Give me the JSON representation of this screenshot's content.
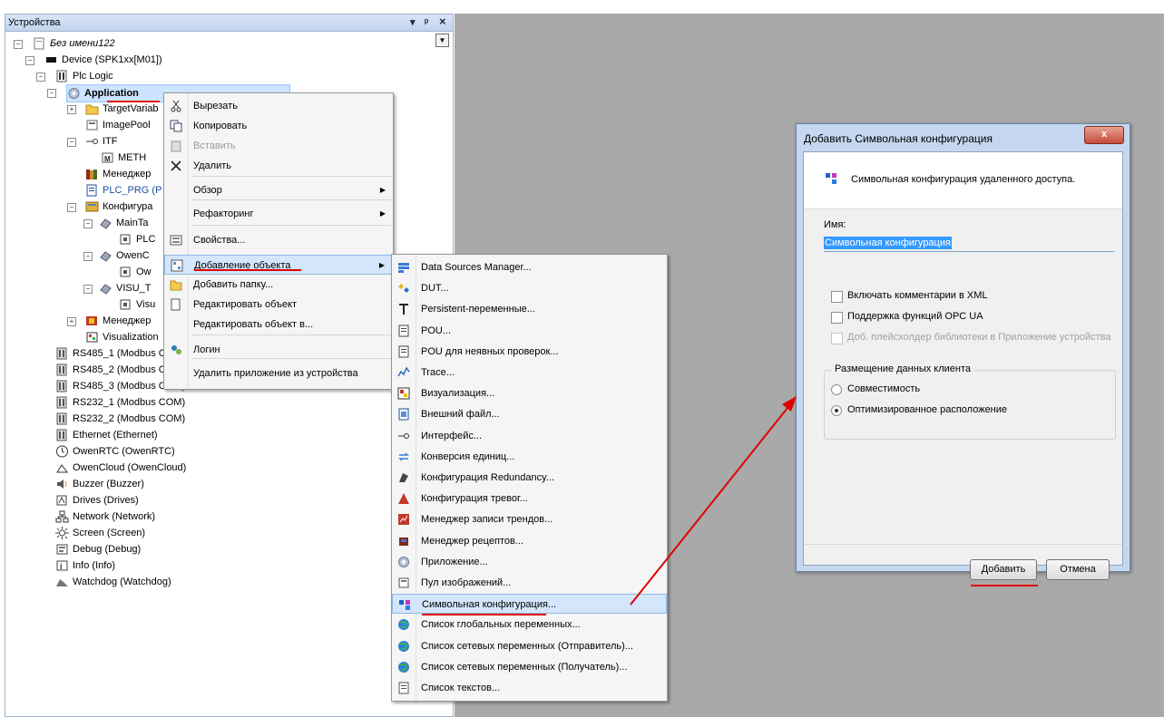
{
  "panel": {
    "title": "Устройства",
    "ctrl_pin": "▾",
    "ctrl_dock": "ᵖ",
    "ctrl_close": "×"
  },
  "tree": [
    {
      "label": "Без имени122",
      "icon": "project-icon"
    },
    {
      "label": "Device (SPK1xx[M01])",
      "icon": "device-icon"
    },
    {
      "label": "Plc Logic",
      "icon": "plc-logic-icon"
    },
    {
      "label": "Application",
      "icon": "application-gear-icon"
    },
    {
      "label": "TargetVariab",
      "icon": "folder-icon"
    },
    {
      "label": "ImagePool",
      "icon": "image-pool-icon"
    },
    {
      "label": "ITF",
      "icon": "interface-icon"
    },
    {
      "label": "METH",
      "icon": "method-icon"
    },
    {
      "label": "Менеджер",
      "icon": "library-manager-icon"
    },
    {
      "label": "PLC_PRG (P",
      "icon": "pou-icon"
    },
    {
      "label": "Конфигура",
      "icon": "task-config-icon"
    },
    {
      "label": "MainTa",
      "icon": "task-icon"
    },
    {
      "label": "PLC",
      "icon": "pou-call-icon"
    },
    {
      "label": "OwenC",
      "icon": "task-icon"
    },
    {
      "label": "Ow",
      "icon": "pou-call-icon"
    },
    {
      "label": "VISU_T",
      "icon": "task-icon"
    },
    {
      "label": "Visu",
      "icon": "pou-call-icon"
    },
    {
      "label": "Менеджер",
      "icon": "visu-manager-icon"
    },
    {
      "label": "Visualization",
      "icon": "visualization-icon"
    },
    {
      "label": "RS485_1 (Modbus C",
      "icon": "port-icon"
    },
    {
      "label": "RS485_2 (Modbus COM)",
      "icon": "port-icon"
    },
    {
      "label": "RS485_3 (Modbus COM)",
      "icon": "port-icon"
    },
    {
      "label": "RS232_1 (Modbus COM)",
      "icon": "port-icon"
    },
    {
      "label": "RS232_2 (Modbus COM)",
      "icon": "port-icon"
    },
    {
      "label": "Ethernet (Ethernet)",
      "icon": "port-icon"
    },
    {
      "label": "OwenRTC (OwenRTC)",
      "icon": "clock-icon"
    },
    {
      "label": "OwenCloud (OwenCloud)",
      "icon": "cloud-icon"
    },
    {
      "label": "Buzzer (Buzzer)",
      "icon": "speaker-icon"
    },
    {
      "label": "Drives (Drives)",
      "icon": "drives-icon"
    },
    {
      "label": "Network (Network)",
      "icon": "network-icon"
    },
    {
      "label": "Screen (Screen)",
      "icon": "screen-icon"
    },
    {
      "label": "Debug (Debug)",
      "icon": "debug-icon"
    },
    {
      "label": "Info (Info)",
      "icon": "info-icon"
    },
    {
      "label": "Watchdog (Watchdog)",
      "icon": "watchdog-icon"
    }
  ],
  "context_menu": [
    {
      "label": "Вырезать",
      "icon": "scissors-icon",
      "disabled": false
    },
    {
      "label": "Копировать",
      "icon": "copy-icon",
      "disabled": false
    },
    {
      "label": "Вставить",
      "icon": "paste-icon",
      "disabled": true
    },
    {
      "label": "Удалить",
      "icon": "delete-x-icon",
      "disabled": false
    },
    {
      "label": "Обзор",
      "icon": "",
      "submenu": true
    },
    {
      "label": "Рефакторинг",
      "icon": "",
      "submenu": true
    },
    {
      "label": "Свойства...",
      "icon": "properties-icon"
    },
    {
      "label": "Добавление объекта",
      "icon": "add-object-icon",
      "submenu": true,
      "highlighted": true
    },
    {
      "label": "Добавить папку...",
      "icon": "folder-icon"
    },
    {
      "label": "Редактировать объект",
      "icon": "edit-object-icon"
    },
    {
      "label": "Редактировать объект в...",
      "icon": ""
    },
    {
      "label": "Логин",
      "icon": "login-icon"
    },
    {
      "label": "Удалить приложение из устройства",
      "icon": ""
    }
  ],
  "submenu": [
    {
      "label": "Data Sources Manager...",
      "icon": "data-sources-icon"
    },
    {
      "label": "DUT...",
      "icon": "dut-icon"
    },
    {
      "label": "Persistent-переменные...",
      "icon": "persistent-icon"
    },
    {
      "label": "POU...",
      "icon": "pou-icon"
    },
    {
      "label": "POU для неявных проверок...",
      "icon": "pou-icon"
    },
    {
      "label": "Trace...",
      "icon": "trace-icon"
    },
    {
      "label": "Визуализация...",
      "icon": "visualization-icon"
    },
    {
      "label": "Внешний файл...",
      "icon": "external-file-icon"
    },
    {
      "label": "Интерфейс...",
      "icon": "interface-icon"
    },
    {
      "label": "Конверсия единиц...",
      "icon": "unit-conversion-icon"
    },
    {
      "label": "Конфигурация Redundancy...",
      "icon": "redundancy-icon"
    },
    {
      "label": "Конфигурация тревог...",
      "icon": "alarm-icon"
    },
    {
      "label": "Менеджер записи трендов...",
      "icon": "trend-icon"
    },
    {
      "label": "Менеджер рецептов...",
      "icon": "recipe-icon"
    },
    {
      "label": "Приложение...",
      "icon": "application-gear-icon"
    },
    {
      "label": "Пул изображений...",
      "icon": "image-pool-icon"
    },
    {
      "label": "Символьная конфигурация...",
      "icon": "symbol-config-icon",
      "highlighted": true
    },
    {
      "label": "Список глобальных переменных...",
      "icon": "globe-icon"
    },
    {
      "label": "Список сетевых переменных (Отправитель)...",
      "icon": "globe-icon"
    },
    {
      "label": "Список сетевых переменных (Получатель)...",
      "icon": "globe-icon"
    },
    {
      "label": "Список текстов...",
      "icon": "text-list-icon"
    }
  ],
  "dialog": {
    "title": "Добавить Символьная конфигурация",
    "close": "x",
    "header_text": "Символьная конфигурация удаленного доступа.",
    "name_label": "Имя:",
    "name_value": "Символьная конфигурация",
    "checkboxes": [
      {
        "label": "Включать комментарии в XML",
        "checked": false,
        "disabled": false
      },
      {
        "label": "Поддержка функций OPC UA",
        "checked": false,
        "disabled": false
      },
      {
        "label": "Доб. плейсхолдер библиотеки в Приложение устройства",
        "checked": false,
        "disabled": true
      }
    ],
    "group_title": "Размещение данных клиента",
    "radios": [
      {
        "label": "Совместимость",
        "selected": false
      },
      {
        "label": "Оптимизированное расположение",
        "selected": true
      }
    ],
    "ok": "Добавить",
    "cancel": "Отмена"
  },
  "colors": {
    "workspace": "#a9a9a9",
    "highlight": "#d4e6fb",
    "annotation_red": "#e00000"
  }
}
